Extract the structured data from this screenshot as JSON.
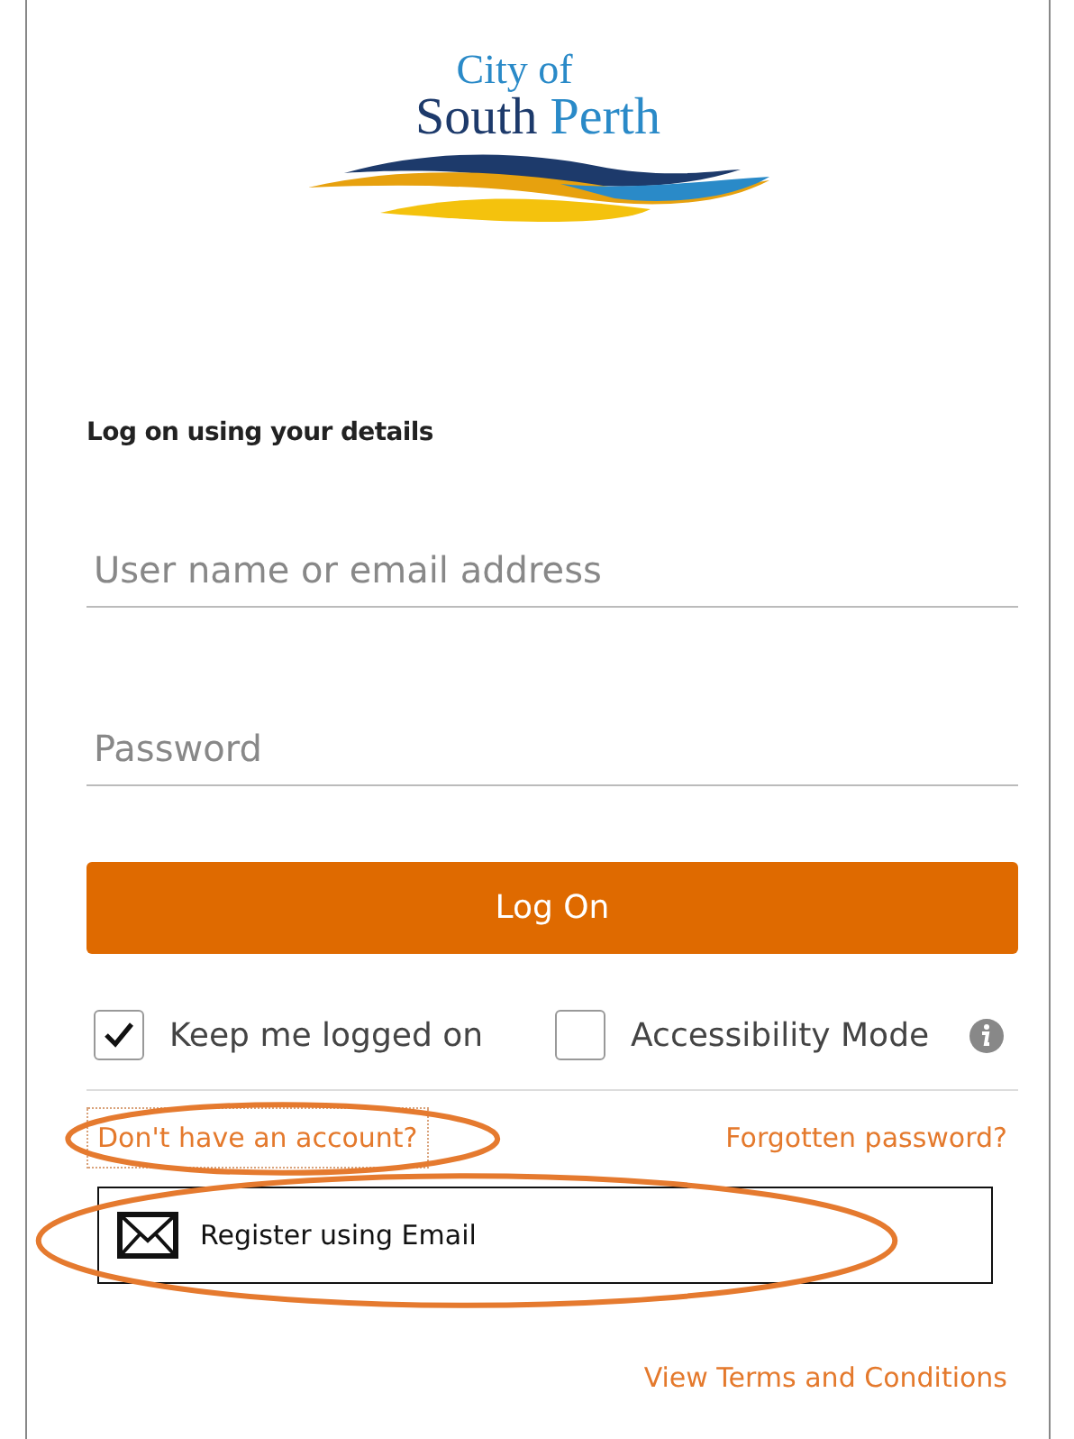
{
  "logo": {
    "line_1": "City of",
    "line_2_part_1": "South",
    "line_2_part_2": "Perth"
  },
  "heading": "Log on using your details",
  "fields": [
    {
      "placeholder": "User name or email address"
    },
    {
      "placeholder": "Password"
    }
  ],
  "logon_button": "Log On",
  "options": [
    {
      "label": "Keep me logged on",
      "checked": true
    },
    {
      "label": "Accessibility Mode",
      "checked": false
    }
  ],
  "account_link": {
    "text": "Don't have an account?",
    "circled": true
  },
  "forgotten_link": {
    "text": "Forgotten password?"
  },
  "register_button": {
    "label": "Register using Email",
    "circled": true
  },
  "terms_link": {
    "text": "View Terms and Conditions"
  }
}
